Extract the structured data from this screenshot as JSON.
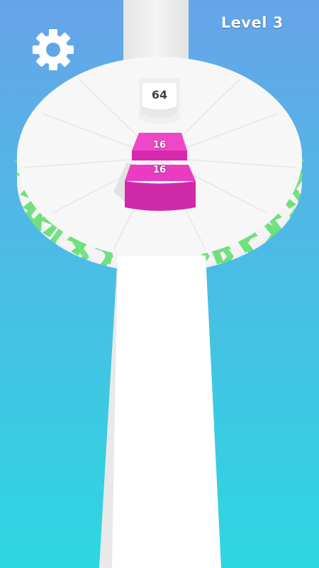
{
  "hud": {
    "level_label": "Level 3"
  },
  "icons": {
    "settings": "gear-icon"
  },
  "tower_block": {
    "value": "64"
  },
  "player_stack": [
    {
      "value": "16",
      "color": "#e030b8"
    },
    {
      "value": "16",
      "color": "#e030b8"
    }
  ],
  "colors": {
    "sky_top": "#6aa8e8",
    "sky_bottom": "#2cd6e2",
    "platform": "#ffffff",
    "chevron": "#6ee07a",
    "stack": "#e030b8"
  }
}
